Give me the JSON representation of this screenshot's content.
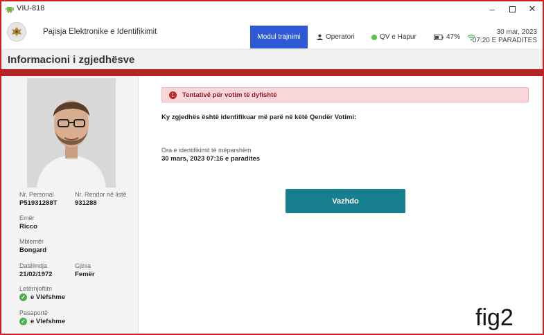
{
  "window": {
    "title": "VIU-818"
  },
  "header": {
    "device_name": "Pajisja Elektronike e Identifikimit",
    "nav": {
      "training_mode": "Modul trajnimi",
      "operators": "Operatori",
      "polling_station": "QV e Hapur"
    },
    "battery": "47%",
    "date": "30 mar, 2023",
    "time": "07:20 E PARADITES"
  },
  "page": {
    "title": "Informacioni i zgjedhësve"
  },
  "voter": {
    "personal_no_label": "Nr. Personal",
    "personal_no": "P51931288T",
    "list_no_label": "Nr. Rendor në listë",
    "list_no": "931288",
    "first_name_label": "Emër",
    "first_name": "Ricco",
    "last_name_label": "Mbiemër",
    "last_name": "Bongard",
    "dob_label": "Datëlindja",
    "dob": "21/02/1972",
    "gender_label": "Gjinia",
    "gender": "Femër",
    "id_card_label": "Letërnjoftim",
    "id_card_status": "e Vlefshme",
    "passport_label": "Pasaportë",
    "passport_status": "e Vlefshme"
  },
  "main": {
    "alert": "Tentativë për votim të dyfishtë",
    "notice": "Ky zgjedhës është identifikuar më parë në këtë Qendër Votimi:",
    "prev_label": "Ora e identifikimit të mëparshëm",
    "prev_value": "30 mars, 2023 07:16 e paradites",
    "continue_label": "Vazhdo"
  },
  "figure_label": "fig2",
  "colors": {
    "accent_nav": "#2f5ad6",
    "primary_button": "#167e8e",
    "alert_bg": "#f8d7da",
    "red_strip": "#b32424",
    "status_green": "#5ac34c"
  }
}
